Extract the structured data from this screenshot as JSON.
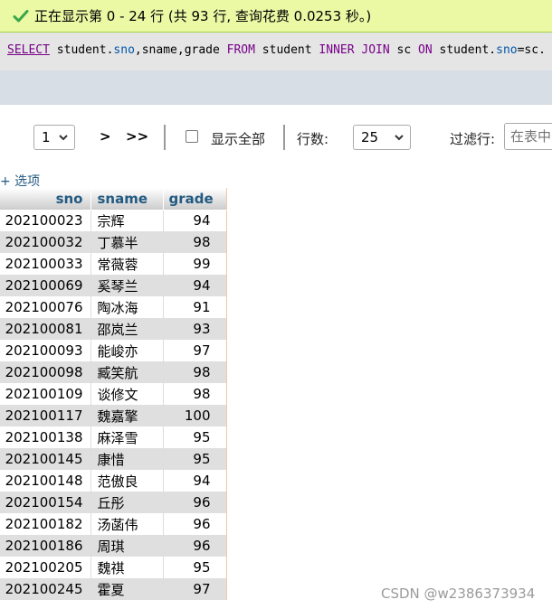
{
  "status": {
    "message": "正在显示第 0 - 24 行 (共 93 行, 查询花费 0.0253 秒。)",
    "icon": "check-icon",
    "color": "#3aa64b"
  },
  "sql": {
    "t1": "SELECT",
    "t2": " student.",
    "t3": "sno",
    "t4": ",sname,grade ",
    "t5": "FROM",
    "t6": " student ",
    "t7": "INNER JOIN",
    "t8": " sc ",
    "t9": "ON",
    "t10": " student.",
    "t11": "sno",
    "t12": "=sc."
  },
  "nav": {
    "page_value": "1",
    "next_label": ">",
    "last_label": ">>",
    "show_all_label": "显示全部",
    "show_all_checked": false,
    "rows_label": "行数:",
    "rows_value": "25",
    "filter_label": "过滤行:",
    "filter_placeholder": "在表中"
  },
  "options_link": "+ 选项",
  "table": {
    "headers": [
      "sno",
      "sname",
      "grade"
    ],
    "rows": [
      [
        "202100023",
        "宗辉",
        "94"
      ],
      [
        "202100032",
        "丁慕半",
        "98"
      ],
      [
        "202100033",
        "常薇蓉",
        "99"
      ],
      [
        "202100069",
        "奚琴兰",
        "94"
      ],
      [
        "202100076",
        "陶冰海",
        "91"
      ],
      [
        "202100081",
        "邵岚兰",
        "93"
      ],
      [
        "202100093",
        "能峻亦",
        "97"
      ],
      [
        "202100098",
        "臧笑航",
        "98"
      ],
      [
        "202100109",
        "谈修文",
        "98"
      ],
      [
        "202100117",
        "魏嘉擎",
        "100"
      ],
      [
        "202100138",
        "麻泽雪",
        "95"
      ],
      [
        "202100145",
        "康惜",
        "95"
      ],
      [
        "202100148",
        "范傲良",
        "94"
      ],
      [
        "202100154",
        "丘彤",
        "96"
      ],
      [
        "202100182",
        "汤菡伟",
        "96"
      ],
      [
        "202100186",
        "周琪",
        "96"
      ],
      [
        "202100205",
        "魏祺",
        "95"
      ],
      [
        "202100245",
        "霍夏",
        "97"
      ]
    ]
  },
  "watermark": "CSDN @w2386373934"
}
